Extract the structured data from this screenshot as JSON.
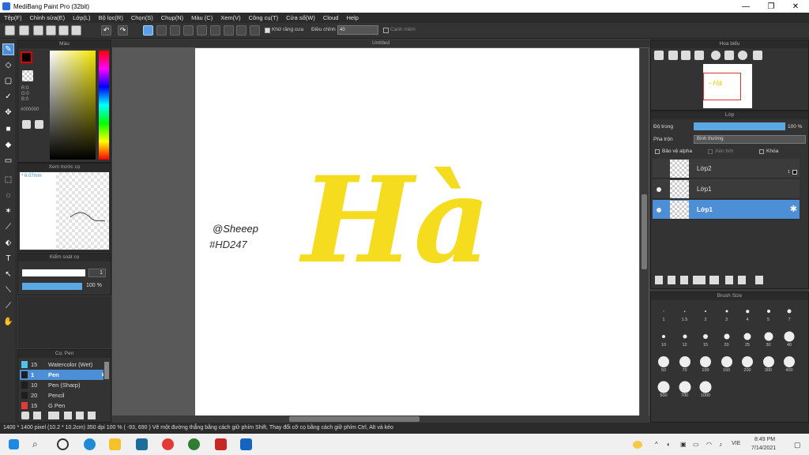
{
  "window": {
    "title": "MediBang Paint Pro (32bit)"
  },
  "menu": [
    "Tệp(F)",
    "Chỉnh sửa(E)",
    "Lớp(L)",
    "Bộ lọc(R)",
    "Chọn(S)",
    "Chụp(N)",
    "Màu (C)",
    "Xem(V)",
    "Công cụ(T)",
    "Cửa sổ(W)",
    "Cloud",
    "Help"
  ],
  "toolbar": {
    "antialias_label": "Khử răng cưa",
    "correction_label": "Điều chỉnh",
    "correction_value": "40",
    "snap_label": "Canh mềm"
  },
  "color_panel": {
    "title": "Màu",
    "r": "R:0",
    "g": "G:0",
    "b": "B:0",
    "hex": "#000000"
  },
  "preview_panel": {
    "title": "Xem trước cọ",
    "size": "* 6.07mm"
  },
  "brush_control": {
    "title": "Kiểm soát cọ",
    "size_value": "1",
    "opacity_value": "100 %"
  },
  "brush_list": {
    "title": "Cọ: Pen",
    "items": [
      {
        "size": "15",
        "name": "Watercolor (Wet)",
        "color": "#4fc3e8"
      },
      {
        "size": "1",
        "name": "Pen",
        "color": "#1e1e1e"
      },
      {
        "size": "10",
        "name": "Pen (Sharp)",
        "color": "#1e1e1e"
      },
      {
        "size": "20",
        "name": "Pencil",
        "color": "#1e1e1e"
      },
      {
        "size": "15",
        "name": "G Pen",
        "color": "#e53935"
      }
    ]
  },
  "canvas": {
    "tab": "Untitled",
    "artwork_text": "Hà",
    "signature_line1": "@Sheeep",
    "signature_line2": "#HD247",
    "artwork_color": "#f6dc1e"
  },
  "navigator": {
    "title": "Hoa biểu",
    "thumb_text": "- Hà"
  },
  "layers": {
    "title": "Lớp",
    "opacity_label": "Độ trong",
    "opacity_value": "100 %",
    "blend_label": "Pha trộn",
    "blend_value": "Bình thường",
    "protect_alpha": "Bảo vệ alpha",
    "clipping": "Xén bớt",
    "lock": "Khóa",
    "items": [
      {
        "name": "Lớp2",
        "visible": false,
        "selected": false
      },
      {
        "name": "Lớp1",
        "visible": true,
        "selected": false
      },
      {
        "name": "Lớp1",
        "visible": true,
        "selected": true
      }
    ]
  },
  "brush_size": {
    "title": "Brush Size",
    "sizes": [
      "1",
      "1.5",
      "2",
      "3",
      "4",
      "5",
      "7",
      "10",
      "12",
      "15",
      "20",
      "25",
      "30",
      "40",
      "50",
      "70",
      "100",
      "150",
      "200",
      "300",
      "400",
      "500",
      "700",
      "1000"
    ]
  },
  "status": {
    "text": "1400 * 1400 pixel   (10.2 * 10.2cm)   350 dpi   100 %   ( -93, 690 )   Vẽ một đường thẳng bằng cách giữ phím Shift, Thay đổi cỡ cọ bằng cách giữ phím Ctrl, Alt và kéo"
  },
  "taskbar": {
    "time": "8:49 PM",
    "date": "7/14/2021",
    "lang": "VIE"
  }
}
